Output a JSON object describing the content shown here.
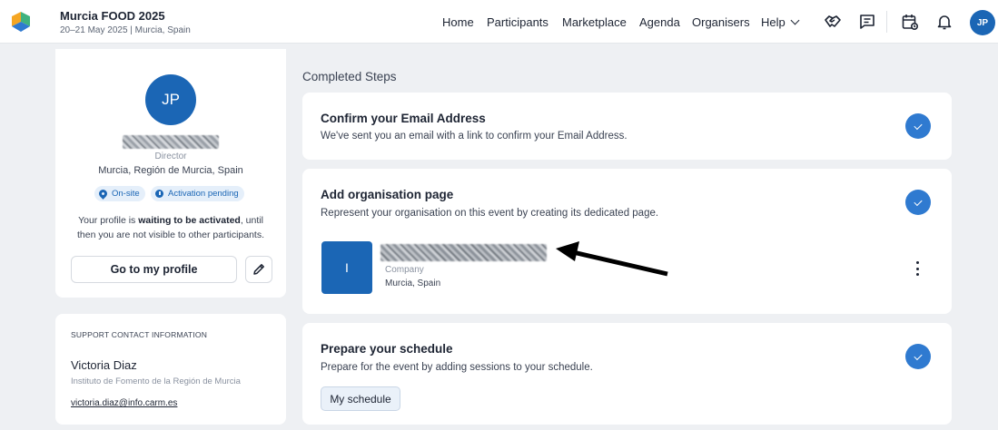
{
  "header": {
    "event_title": "Murcia FOOD 2025",
    "event_subtitle": "20–21 May 2025 | Murcia, Spain",
    "nav": [
      "Home",
      "Participants",
      "Marketplace",
      "Agenda",
      "Organisers"
    ],
    "help_label": "Help",
    "icons": [
      "handshake-icon",
      "chat-icon",
      "calendar-icon",
      "bell-icon"
    ],
    "avatar_initials": "JP",
    "brand_color": "#1b66b5"
  },
  "profile": {
    "initials": "JP",
    "role": "Director",
    "location": "Murcia, Región de Murcia, Spain",
    "badges": [
      "On-site",
      "Activation pending"
    ],
    "note_prefix": "Your profile is ",
    "note_bold": "waiting to be activated",
    "note_suffix": ", until then you are not visible to other participants.",
    "goto_label": "Go to my profile"
  },
  "support": {
    "heading": "SUPPORT CONTACT INFORMATION",
    "name": "Victoria Diaz",
    "organisation": "Instituto de Fomento de la Región de Murcia",
    "email": "victoria.diaz@info.carm.es"
  },
  "steps": {
    "section_title": "Completed Steps",
    "items": [
      {
        "title": "Confirm your Email Address",
        "description": "We've sent you an email with a link to confirm your Email Address."
      },
      {
        "title": "Add organisation page",
        "description": "Represent your organisation on this event by creating its dedicated page."
      },
      {
        "title": "Prepare your schedule",
        "description": "Prepare for the event by adding sessions to your schedule.",
        "button": "My schedule"
      }
    ],
    "organisation": {
      "logo_letter": "I",
      "type": "Company",
      "location": "Murcia, Spain"
    }
  }
}
